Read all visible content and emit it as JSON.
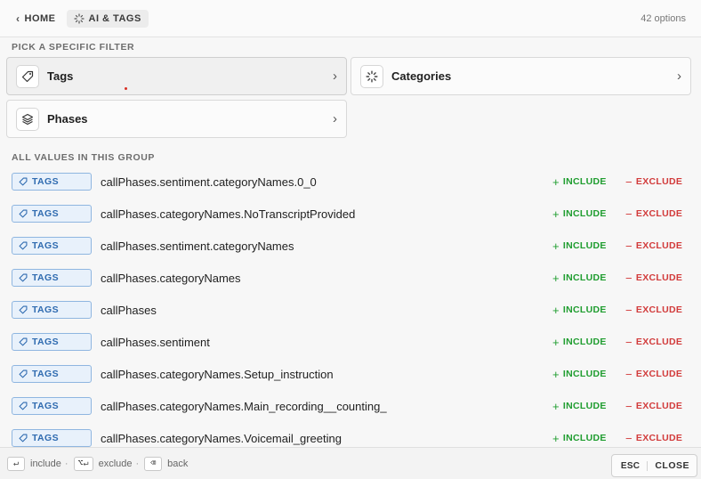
{
  "header": {
    "home_label": "HOME",
    "current_label": "AI & TAGS",
    "options_count": "42 options"
  },
  "sections": {
    "pick_label": "PICK A SPECIFIC FILTER",
    "values_label": "ALL VALUES IN THIS GROUP"
  },
  "filters": [
    {
      "label": "Tags",
      "icon": "tag-icon",
      "selected": true
    },
    {
      "label": "Categories",
      "icon": "spinner-icon",
      "selected": false
    },
    {
      "label": "Phases",
      "icon": "layers-icon",
      "selected": false
    }
  ],
  "row_actions": {
    "include_label": "INCLUDE",
    "exclude_label": "EXCLUDE"
  },
  "rows": [
    {
      "badge": "TAGS",
      "value": "callPhases.sentiment.categoryNames.0_0"
    },
    {
      "badge": "TAGS",
      "value": "callPhases.categoryNames.NoTranscriptProvided"
    },
    {
      "badge": "TAGS",
      "value": "callPhases.sentiment.categoryNames"
    },
    {
      "badge": "TAGS",
      "value": "callPhases.categoryNames"
    },
    {
      "badge": "TAGS",
      "value": "callPhases"
    },
    {
      "badge": "TAGS",
      "value": "callPhases.sentiment"
    },
    {
      "badge": "TAGS",
      "value": "callPhases.categoryNames.Setup_instruction"
    },
    {
      "badge": "TAGS",
      "value": "callPhases.categoryNames.Main_recording__counting_"
    },
    {
      "badge": "TAGS",
      "value": "callPhases.categoryNames.Voicemail_greeting"
    }
  ],
  "footer": {
    "include_key": "↵",
    "include_hint": "include",
    "exclude_key": "⌥↵",
    "exclude_hint": "exclude",
    "back_key": "⌫",
    "back_hint": "back",
    "close_key": "ESC",
    "close_label": "CLOSE"
  },
  "colors": {
    "include": "#1f9d2f",
    "exclude": "#d23b3b",
    "badge_text": "#2f6bb0",
    "badge_bg": "#e8f1fb"
  }
}
